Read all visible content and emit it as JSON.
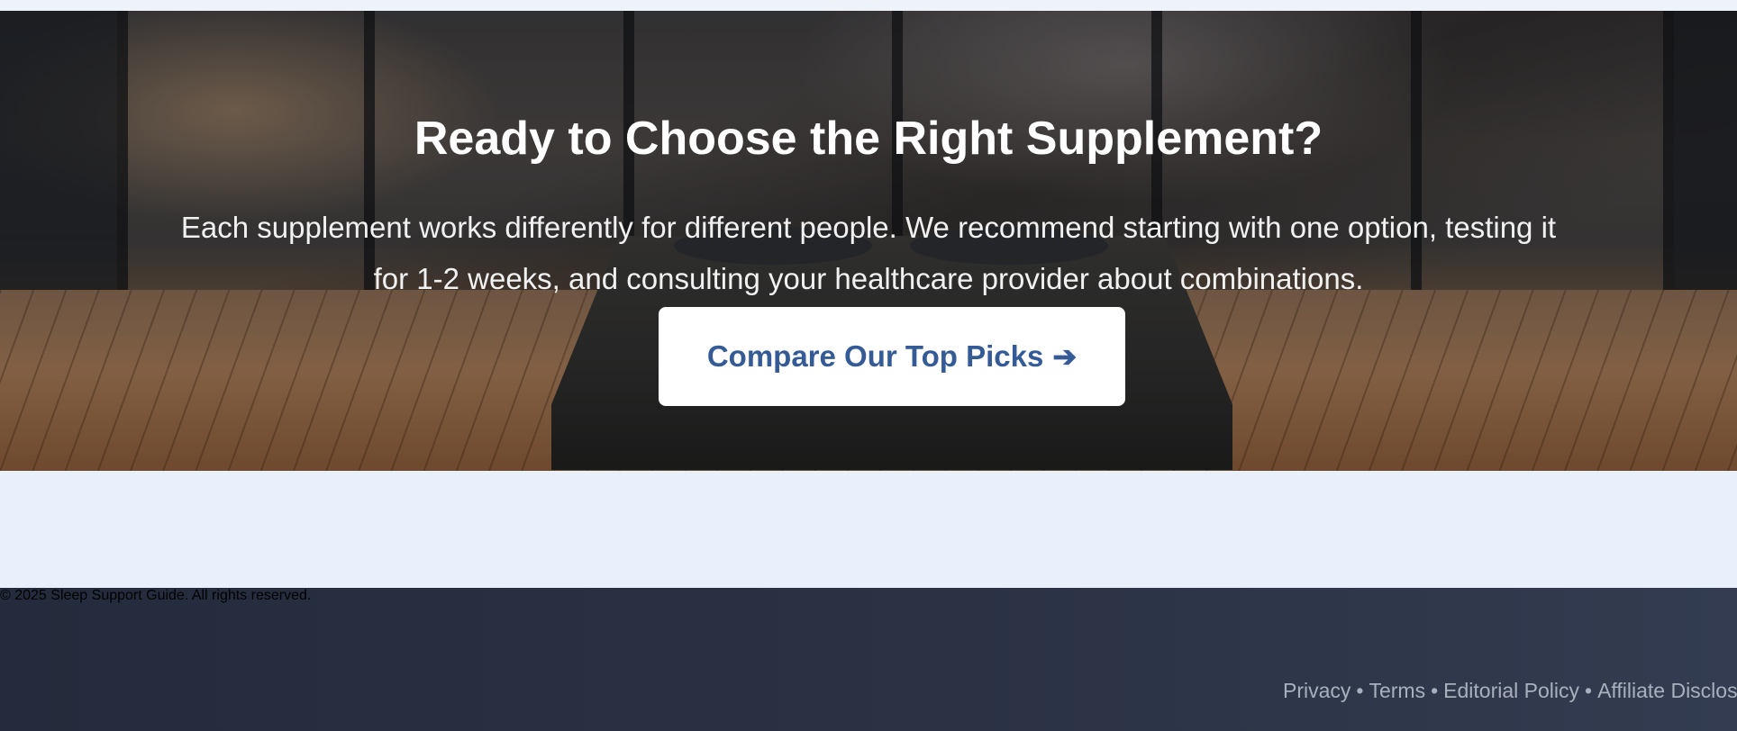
{
  "hero": {
    "title": "Ready to Choose the Right Supplement?",
    "subtitle": "Each supplement works differently for different people. We recommend starting with one option, testing it for 1-2 weeks, and consulting your healthcare provider about combinations.",
    "cta_label": "Compare Our Top Picks",
    "cta_icon": "arrow-right-icon"
  },
  "footer": {
    "copyright": "© 2025 Sleep Support Guide. All rights reserved.",
    "links": [
      "Privacy",
      "Terms",
      "Editorial Policy",
      "Affiliate Disclosure"
    ],
    "separator": "•"
  },
  "colors": {
    "cta_text": "#355b96",
    "footer_bg": "#2a3244",
    "page_bg": "#e8f1fb"
  }
}
